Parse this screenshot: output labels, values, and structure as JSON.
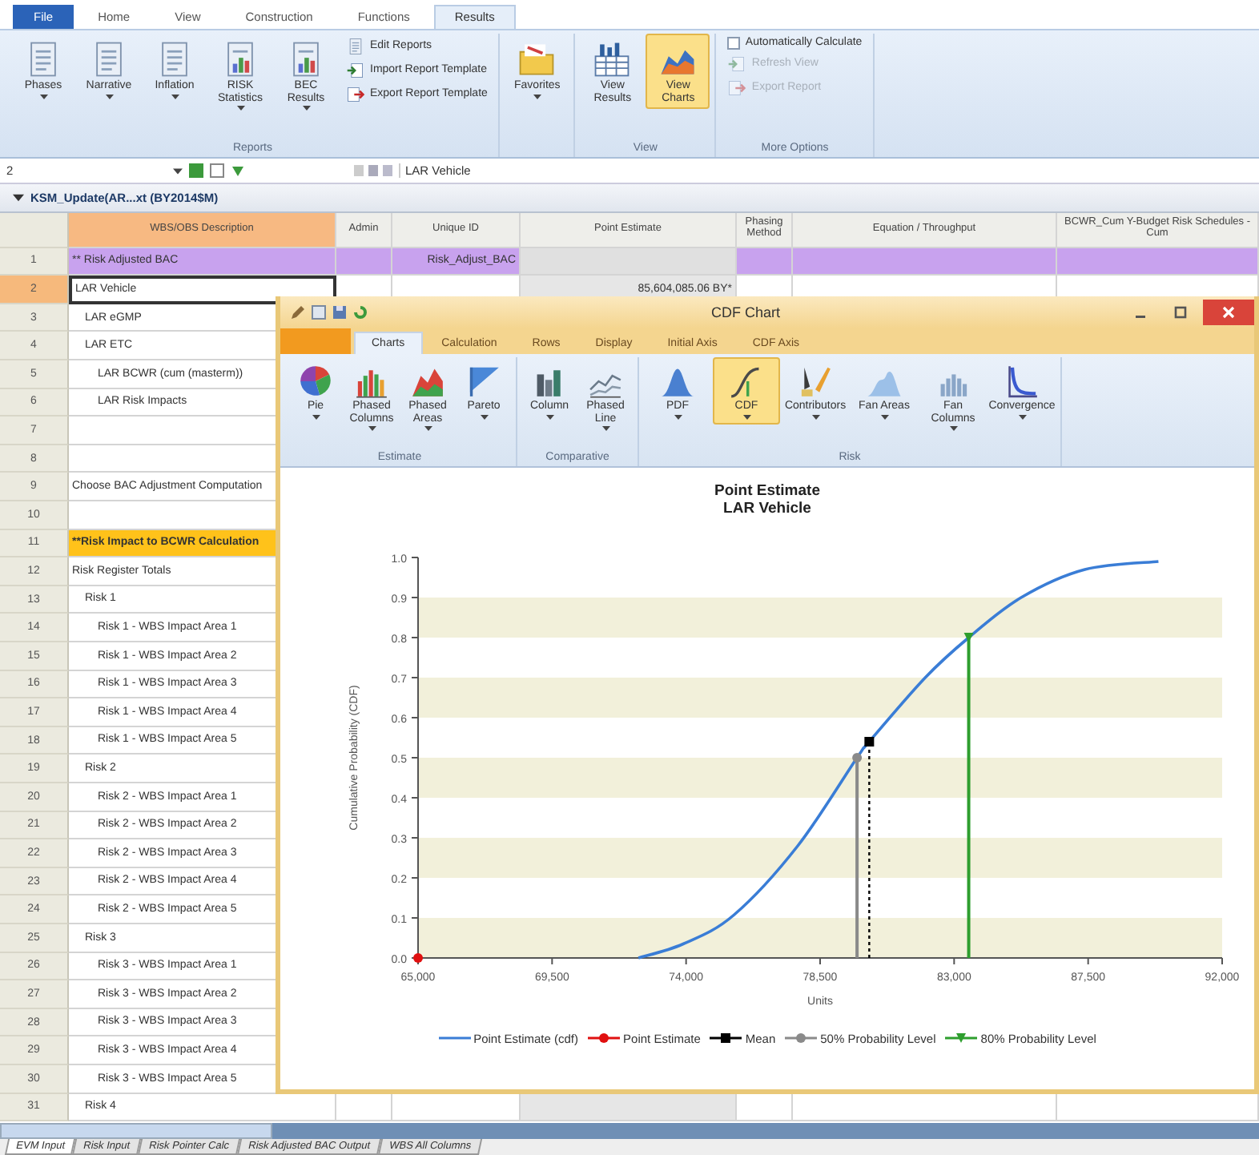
{
  "app_tabs": [
    {
      "label": "File",
      "kind": "file",
      "selected": false
    },
    {
      "label": "Home",
      "kind": "tab",
      "selected": false
    },
    {
      "label": "View",
      "kind": "tab",
      "selected": false
    },
    {
      "label": "Construction",
      "kind": "tab",
      "selected": false
    },
    {
      "label": "Functions",
      "kind": "tab",
      "selected": false
    },
    {
      "label": "Results",
      "kind": "tab",
      "selected": true
    }
  ],
  "ribbon": {
    "groups": [
      {
        "label": "Reports",
        "buttons": [
          {
            "label": "Phases",
            "dropdown": true,
            "selected": false
          },
          {
            "label": "Narrative",
            "dropdown": true,
            "selected": false
          },
          {
            "label": "Inflation",
            "dropdown": true,
            "selected": false
          },
          {
            "label": "RISK Statistics",
            "dropdown": true,
            "selected": false
          },
          {
            "label": "BEC Results",
            "dropdown": true,
            "selected": false
          }
        ],
        "items": [
          {
            "label": "Edit Reports",
            "kind": "command",
            "disabled": false
          },
          {
            "label": "Import Report Template",
            "kind": "command",
            "disabled": false
          },
          {
            "label": "Export Report Template",
            "kind": "command",
            "disabled": false
          }
        ]
      },
      {
        "buttons": [
          {
            "label": "Favorites",
            "dropdown": true,
            "selected": false
          }
        ]
      },
      {
        "label": "View",
        "buttons": [
          {
            "label": "View Results",
            "selected": false
          },
          {
            "label": "View Charts",
            "selected": true
          }
        ]
      },
      {
        "label": "More Options",
        "items": [
          {
            "label": "Automatically Calculate",
            "kind": "checkbox",
            "checked": false,
            "disabled": false
          },
          {
            "label": "Refresh View",
            "kind": "command",
            "disabled": true
          },
          {
            "label": "Export Report",
            "kind": "command",
            "disabled": true
          }
        ]
      }
    ]
  },
  "formula_bar": {
    "cell_ref": "2",
    "value": "LAR Vehicle"
  },
  "workbook_title": "KSM_Update(AR...xt (BY2014$M)",
  "grid": {
    "columns": [
      {
        "label": "WBS/OBS Description",
        "selected": true
      },
      {
        "label": "Admin",
        "selected": false
      },
      {
        "label": "Unique ID",
        "selected": false
      },
      {
        "label": "Point Estimate",
        "selected": false
      },
      {
        "label": "Phasing Method",
        "selected": false
      },
      {
        "label": "Equation / Throughput",
        "selected": false
      },
      {
        "label": "BCWR_Cum Y-Budget Risk Schedules - Cum",
        "selected": false
      }
    ],
    "rows": [
      {
        "num": "1",
        "description": "** Risk Adjusted BAC",
        "kind": "section",
        "selected": false,
        "unique_id": "Risk_Adjust_BAC"
      },
      {
        "num": "2",
        "description": "LAR Vehicle",
        "kind": "plain",
        "selected": true,
        "point_estimate": "85,604,085.06 BY*",
        "children": [
          {
            "num": "3",
            "description": "LAR eGMP",
            "kind": "plain",
            "selected": false
          },
          {
            "num": "4",
            "description": "LAR ETC",
            "kind": "plain",
            "selected": false,
            "children": [
              {
                "num": "5",
                "description": "LAR BCWR (cum (masterm))",
                "kind": "plain",
                "selected": false
              },
              {
                "num": "6",
                "description": "LAR Risk Impacts",
                "kind": "plain",
                "selected": false
              }
            ]
          }
        ]
      },
      {
        "num": "7",
        "kind": "plain",
        "selected": false
      },
      {
        "num": "8",
        "kind": "plain",
        "selected": false
      },
      {
        "num": "9",
        "description": "Choose BAC Adjustment Computation",
        "kind": "plain",
        "selected": false
      },
      {
        "num": "10",
        "kind": "plain",
        "selected": false
      },
      {
        "num": "11",
        "description": "**Risk Impact to BCWR Calculation",
        "kind": "highlight",
        "selected": false
      },
      {
        "num": "12",
        "description": "Risk Register Totals",
        "kind": "plain",
        "selected": false,
        "children": [
          {
            "num": "13",
            "description": "Risk 1",
            "kind": "plain",
            "selected": false,
            "children": [
              {
                "num": "14",
                "description": "Risk 1 - WBS Impact Area 1",
                "kind": "plain",
                "selected": false
              },
              {
                "num": "15",
                "description": "Risk 1 - WBS Impact Area 2",
                "kind": "plain",
                "selected": false
              },
              {
                "num": "16",
                "description": "Risk 1 - WBS Impact Area 3",
                "kind": "plain",
                "selected": false
              },
              {
                "num": "17",
                "description": "Risk 1 - WBS Impact Area 4",
                "kind": "plain",
                "selected": false
              },
              {
                "num": "18",
                "description": "Risk 1 - WBS Impact Area 5",
                "kind": "plain",
                "selected": false
              }
            ]
          },
          {
            "num": "19",
            "description": "Risk 2",
            "kind": "plain",
            "selected": false,
            "children": [
              {
                "num": "20",
                "description": "Risk 2 - WBS Impact Area 1",
                "kind": "plain",
                "selected": false
              },
              {
                "num": "21",
                "description": "Risk 2 - WBS Impact Area 2",
                "kind": "plain",
                "selected": false
              },
              {
                "num": "22",
                "description": "Risk 2 - WBS Impact Area 3",
                "kind": "plain",
                "selected": false
              },
              {
                "num": "23",
                "description": "Risk 2 - WBS Impact Area 4",
                "kind": "plain",
                "selected": false
              },
              {
                "num": "24",
                "description": "Risk 2 - WBS Impact Area 5",
                "kind": "plain",
                "selected": false
              }
            ]
          },
          {
            "num": "25",
            "description": "Risk 3",
            "kind": "plain",
            "selected": false,
            "children": [
              {
                "num": "26",
                "description": "Risk 3 - WBS Impact Area 1",
                "kind": "plain",
                "selected": false
              },
              {
                "num": "27",
                "description": "Risk 3 - WBS Impact Area 2",
                "kind": "plain",
                "selected": false
              },
              {
                "num": "28",
                "description": "Risk 3 - WBS Impact Area 3",
                "kind": "plain",
                "selected": false
              },
              {
                "num": "29",
                "description": "Risk 3 - WBS Impact Area 4",
                "kind": "plain",
                "selected": false
              },
              {
                "num": "30",
                "description": "Risk 3 - WBS Impact Area 5",
                "kind": "plain",
                "selected": false
              }
            ]
          },
          {
            "num": "31",
            "description": "Risk 4",
            "kind": "plain",
            "selected": false
          }
        ]
      }
    ]
  },
  "sheet_tabs": [
    {
      "label": "EVM Input",
      "selected": true
    },
    {
      "label": "Risk Input",
      "selected": false
    },
    {
      "label": "Risk Pointer Calc",
      "selected": false
    },
    {
      "label": "Risk Adjusted BAC Output",
      "selected": false
    },
    {
      "label": "WBS All Columns",
      "selected": false
    }
  ],
  "chart_window": {
    "title": "CDF Chart",
    "tabs": [
      {
        "label": "Charts",
        "selected": true
      },
      {
        "label": "Calculation",
        "selected": false
      },
      {
        "label": "Rows",
        "selected": false
      },
      {
        "label": "Display",
        "selected": false
      },
      {
        "label": "Initial Axis",
        "selected": false
      },
      {
        "label": "CDF Axis",
        "selected": false
      }
    ],
    "ribbon": {
      "groups": [
        {
          "label": "Estimate",
          "buttons": [
            {
              "label": "Pie",
              "dropdown": true,
              "selected": false
            },
            {
              "label": "Phased Columns",
              "dropdown": true,
              "selected": false
            },
            {
              "label": "Phased Areas",
              "dropdown": true,
              "selected": false
            },
            {
              "label": "Pareto",
              "dropdown": true,
              "selected": false
            }
          ]
        },
        {
          "label": "Comparative",
          "buttons": [
            {
              "label": "Column",
              "dropdown": true,
              "selected": false
            },
            {
              "label": "Phased Line",
              "dropdown": true,
              "selected": false
            }
          ]
        },
        {
          "label": "Risk",
          "buttons": [
            {
              "label": "PDF",
              "dropdown": true,
              "selected": false
            },
            {
              "label": "CDF",
              "dropdown": true,
              "selected": true
            },
            {
              "label": "Contributors",
              "dropdown": true,
              "selected": false
            },
            {
              "label": "Fan Areas",
              "dropdown": true,
              "selected": false
            },
            {
              "label": "Fan Columns",
              "dropdown": true,
              "selected": false
            },
            {
              "label": "Convergence",
              "dropdown": true,
              "selected": false
            }
          ]
        }
      ]
    },
    "chart": {
      "subtitle": "LAR Vehicle",
      "chart_data": {
        "type": "line",
        "title": "Point Estimate",
        "xlabel": "Units",
        "ylabel": "Cumulative Probability (CDF)",
        "x": [
          65000,
          72400,
          73900,
          75600,
          77750,
          79740,
          79740,
          80150,
          80150,
          82030,
          83490,
          83490,
          85250,
          87390,
          89860
        ],
        "series": [
          {
            "name": "Point Estimate (cdf)",
            "color": "#3a7dd6",
            "values": [
              null,
              0,
              0.035,
              0.107,
              0.28,
              null,
              0.5,
              null,
              0.54,
              0.7,
              null,
              0.8,
              0.9,
              0.97,
              0.99
            ]
          },
          {
            "name": "Point Estimate",
            "color": "#e01010",
            "marker": "circle",
            "values": [
              0,
              null,
              null,
              null,
              null,
              null,
              null,
              null,
              null,
              null,
              null,
              null,
              null,
              null,
              null
            ]
          },
          {
            "name": "Mean",
            "color": "#000000",
            "marker": "square",
            "line_style": "dotted",
            "values": [
              null,
              null,
              null,
              null,
              null,
              null,
              null,
              0,
              0.54,
              null,
              null,
              null,
              null,
              null,
              null
            ]
          },
          {
            "name": "50% Probability Level",
            "color": "#8a8a8a",
            "marker": "circle",
            "values": [
              null,
              null,
              null,
              null,
              null,
              0,
              0.5,
              null,
              null,
              null,
              null,
              null,
              null,
              null,
              null
            ]
          },
          {
            "name": "80% Probability Level",
            "color": "#2e9e2e",
            "marker": "triangle",
            "values": [
              null,
              null,
              null,
              null,
              null,
              null,
              null,
              null,
              null,
              null,
              0,
              0.8,
              null,
              null,
              null
            ]
          }
        ],
        "xlim": [
          65000,
          92000
        ],
        "ylim": [
          0,
          1
        ],
        "xticks": [
          {
            "value": 65000,
            "label": "65,000"
          },
          {
            "value": 69500,
            "label": "69,500"
          },
          {
            "value": 74000,
            "label": "74,000"
          },
          {
            "value": 78500,
            "label": "78,500"
          },
          {
            "value": 83000,
            "label": "83,000"
          },
          {
            "value": 87500,
            "label": "87,500"
          },
          {
            "value": 92000,
            "label": "92,000"
          }
        ],
        "yticks": [
          {
            "value": 0,
            "label": "0.0"
          },
          {
            "value": 0.1,
            "label": "0.1"
          },
          {
            "value": 0.2,
            "label": "0.2"
          },
          {
            "value": 0.3,
            "label": "0.3"
          },
          {
            "value": 0.4,
            "label": "0.4"
          },
          {
            "value": 0.5,
            "label": "0.5"
          },
          {
            "value": 0.6,
            "label": "0.6"
          },
          {
            "value": 0.7,
            "label": "0.7"
          },
          {
            "value": 0.8,
            "label": "0.8"
          },
          {
            "value": 0.9,
            "label": "0.9"
          },
          {
            "value": 1,
            "label": "1.0"
          }
        ]
      }
    }
  }
}
